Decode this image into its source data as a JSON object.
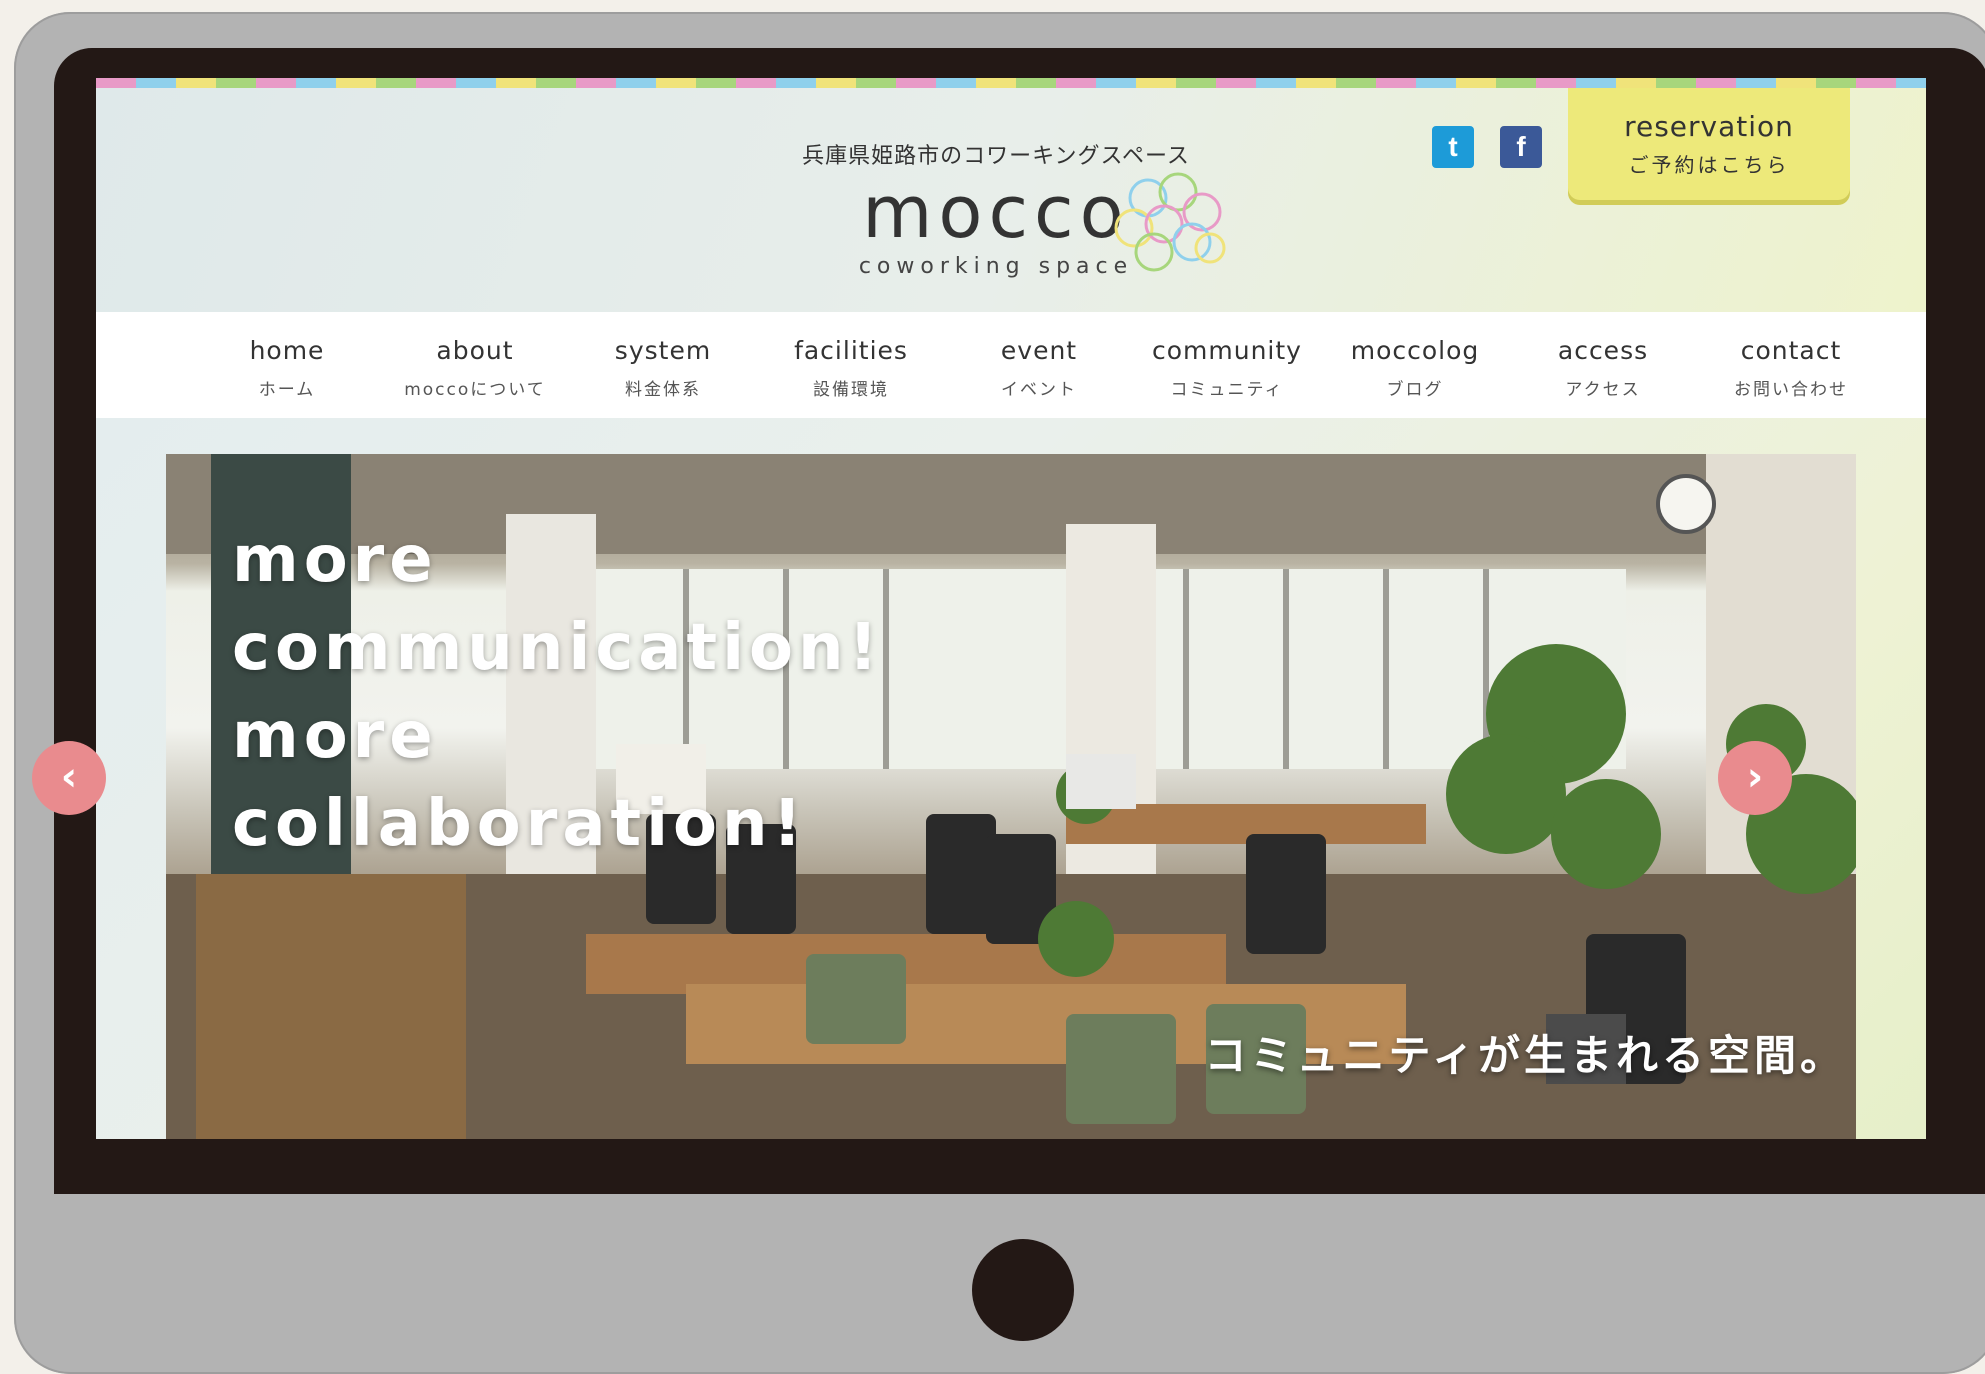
{
  "header": {
    "tagline": "兵庫県姫路市のコワーキングスペース",
    "logo_text": "mocco",
    "logo_sub": "coworking space"
  },
  "social": {
    "twitter": "t",
    "facebook": "f"
  },
  "reservation": {
    "label_en": "reservation",
    "label_jp": "ご予約はこちら"
  },
  "nav": {
    "items": [
      {
        "en": "home",
        "jp": "ホーム"
      },
      {
        "en": "about",
        "jp": "moccoについて"
      },
      {
        "en": "system",
        "jp": "料金体系"
      },
      {
        "en": "facilities",
        "jp": "設備環境"
      },
      {
        "en": "event",
        "jp": "イベント"
      },
      {
        "en": "community",
        "jp": "コミュニティ"
      },
      {
        "en": "moccolog",
        "jp": "ブログ"
      },
      {
        "en": "access",
        "jp": "アクセス"
      },
      {
        "en": "contact",
        "jp": "お問い合わせ"
      }
    ]
  },
  "hero": {
    "heading_lines": [
      "more",
      "communication!",
      "more",
      "collaboration!"
    ],
    "caption": "コミュニティが生まれる空間。",
    "prev_icon": "‹",
    "next_icon": "›"
  },
  "colors": {
    "reservation_bg": "#ede97a",
    "twitter": "#1d9bd8",
    "facebook": "#3b5998",
    "arrow": "#e98b8e",
    "bezel": "#231815"
  }
}
